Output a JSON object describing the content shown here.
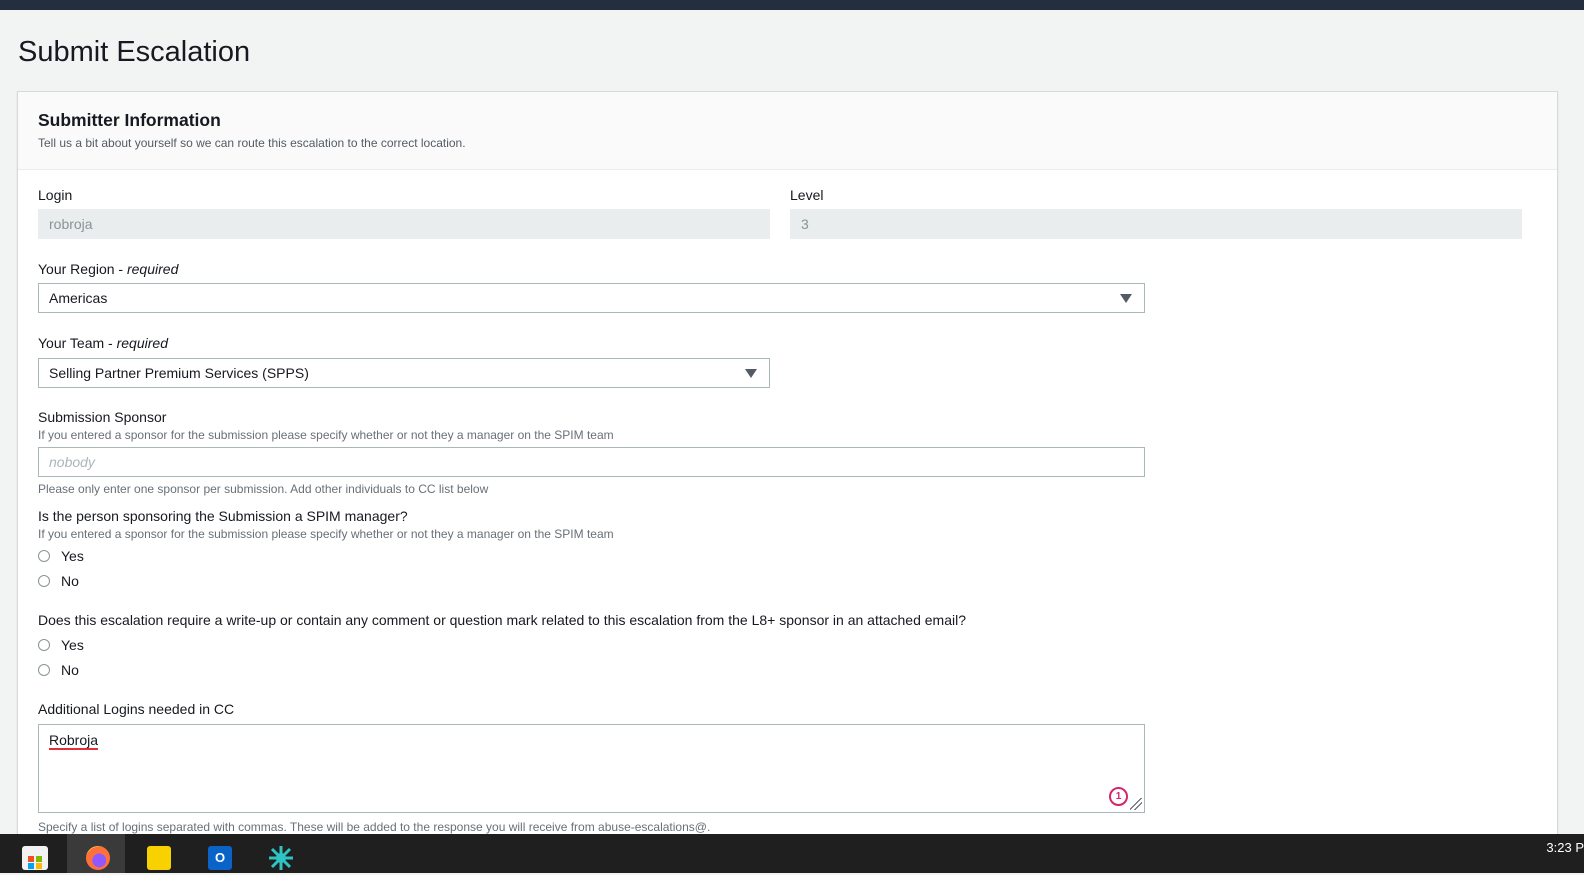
{
  "page": {
    "title": "Submit Escalation"
  },
  "section": {
    "title": "Submitter Information",
    "description": "Tell us a bit about yourself so we can route this escalation to the correct location."
  },
  "fields": {
    "login": {
      "label": "Login",
      "value": "robroja"
    },
    "level": {
      "label": "Level",
      "value": "3"
    },
    "region": {
      "label": "Your Region - ",
      "required": "required",
      "value": "Americas"
    },
    "team": {
      "label": "Your Team - ",
      "required": "required",
      "value": "Selling Partner Premium Services (SPPS)"
    },
    "sponsor": {
      "label": "Submission Sponsor",
      "description": "If you entered a sponsor for the submission please specify whether or not they a manager on the SPIM team",
      "placeholder": "nobody",
      "hint": "Please only enter one sponsor per submission. Add other individuals to CC list below"
    },
    "spim_manager": {
      "label": "Is the person sponsoring the Submission a SPIM manager?",
      "description": "If you entered a sponsor for the submission please specify whether or not they a manager on the SPIM team",
      "options": [
        "Yes",
        "No"
      ]
    },
    "writeup": {
      "label": "Does this escalation require a write-up or contain any comment or question mark related to this escalation from the L8+ sponsor in an attached email?",
      "options": [
        "Yes",
        "No"
      ]
    },
    "cc": {
      "label": "Additional Logins needed in CC",
      "value": "Robroja",
      "badge": "1",
      "hint": "Specify a list of logins separated with commas. These will be added to the response you will receive from abuse-escalations@."
    }
  },
  "taskbar": {
    "apps": [
      "store-icon",
      "firefox-icon",
      "sticky-notes-icon",
      "outlook-icon",
      "app-icon"
    ],
    "clock": "3:23 P"
  },
  "colors": {
    "accent": "#0073bb",
    "header": "#232f3e",
    "spell_error": "#e0303a",
    "badge": "#d6256b"
  }
}
